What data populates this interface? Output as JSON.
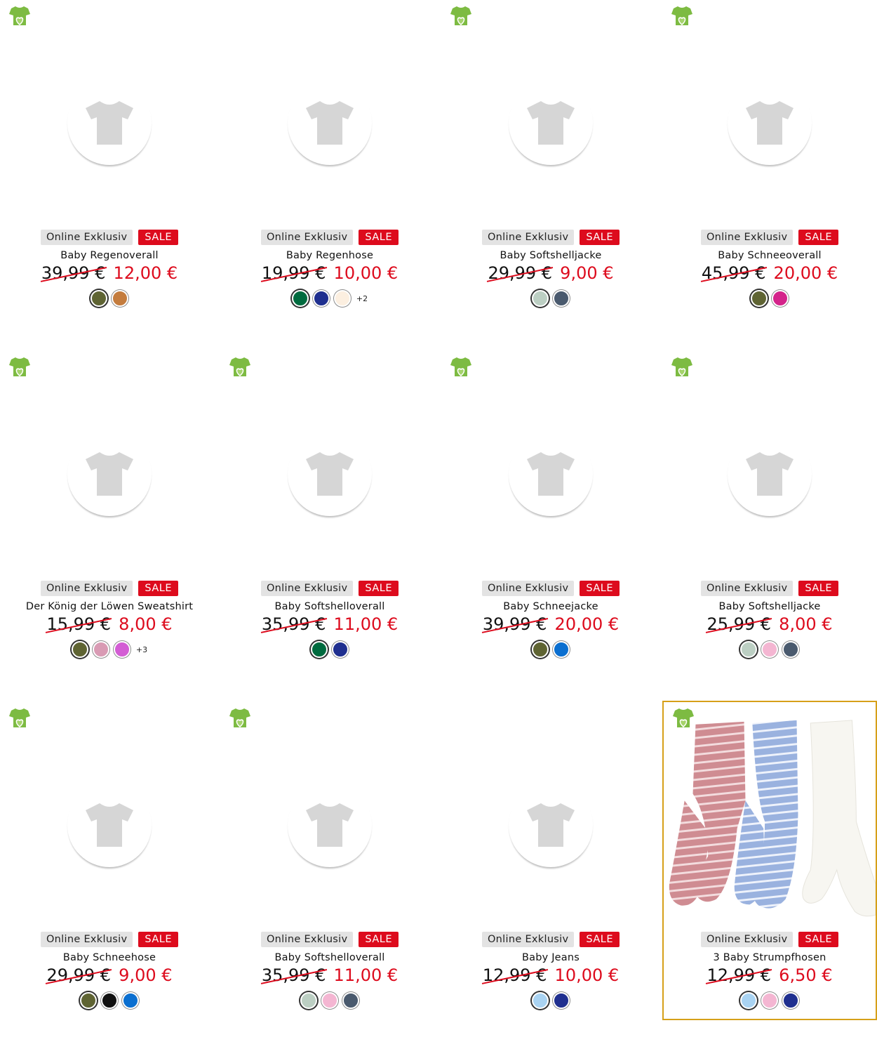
{
  "badges": {
    "online": "Online Exklusiv",
    "sale": "SALE"
  },
  "products": [
    {
      "name": "Baby Regenoverall",
      "old_price": "39,99 €",
      "new_price": "12,00 €",
      "eco": true,
      "image": "placeholder",
      "swatches": [
        "#5f6433",
        "#c47c3e"
      ],
      "more": ""
    },
    {
      "name": "Baby Regenhose",
      "old_price": "19,99 €",
      "new_price": "10,00 €",
      "eco": false,
      "image": "placeholder",
      "swatches": [
        "#006b3f",
        "#1f2f8f",
        "#fcefe0"
      ],
      "more": "+2"
    },
    {
      "name": "Baby Softshelljacke",
      "old_price": "29,99 €",
      "new_price": "9,00 €",
      "eco": true,
      "image": "placeholder",
      "swatches": [
        "#bccfc3",
        "#4a5a6e"
      ],
      "more": ""
    },
    {
      "name": "Baby Schneeoverall",
      "old_price": "45,99 €",
      "new_price": "20,00 €",
      "eco": true,
      "image": "placeholder",
      "swatches": [
        "#5f6433",
        "#d4238a"
      ],
      "more": ""
    },
    {
      "name": "Der König der Löwen Sweatshirt",
      "old_price": "15,99 €",
      "new_price": "8,00 €",
      "eco": true,
      "image": "placeholder",
      "swatches": [
        "#5f6433",
        "#d99bb4",
        "#d35dd4"
      ],
      "more": "+3"
    },
    {
      "name": "Baby Softshelloverall",
      "old_price": "35,99 €",
      "new_price": "11,00 €",
      "eco": true,
      "image": "placeholder",
      "swatches": [
        "#006b3f",
        "#1f2f8f"
      ],
      "more": ""
    },
    {
      "name": "Baby Schneejacke",
      "old_price": "39,99 €",
      "new_price": "20,00 €",
      "eco": true,
      "image": "placeholder",
      "swatches": [
        "#5f6433",
        "#0b6fd0"
      ],
      "more": ""
    },
    {
      "name": "Baby Softshelljacke",
      "old_price": "25,99 €",
      "new_price": "8,00 €",
      "eco": true,
      "image": "placeholder",
      "swatches": [
        "#bccfc3",
        "#f4b6d2",
        "#4a5a6e"
      ],
      "more": ""
    },
    {
      "name": "Baby Schneehose",
      "old_price": "29,99 €",
      "new_price": "9,00 €",
      "eco": true,
      "image": "placeholder",
      "swatches": [
        "#5f6433",
        "#111111",
        "#0b6fd0"
      ],
      "more": ""
    },
    {
      "name": "Baby Softshelloverall",
      "old_price": "35,99 €",
      "new_price": "11,00 €",
      "eco": true,
      "image": "placeholder",
      "swatches": [
        "#bccfc3",
        "#f4b6d2",
        "#4a5a6e"
      ],
      "more": ""
    },
    {
      "name": "Baby Jeans",
      "old_price": "12,99 €",
      "new_price": "10,00 €",
      "eco": false,
      "image": "placeholder",
      "swatches": [
        "#a9d3f2",
        "#1f2f8f"
      ],
      "more": ""
    },
    {
      "name": "3 Baby Strumpfhosen",
      "old_price": "12,99 €",
      "new_price": "6,50 €",
      "eco": true,
      "image": "tights-photo",
      "swatches": [
        "#a9d3f2",
        "#f4b6d2",
        "#1f2f8f"
      ],
      "more": "",
      "selected": true
    }
  ],
  "colors": {
    "sale_red": "#dd0b1d",
    "eco_green": "#7dbb42",
    "selected_border": "#d6a019"
  },
  "icons": {
    "eco": "eco-shirt-heart-icon",
    "placeholder": "tshirt-placeholder-icon"
  }
}
